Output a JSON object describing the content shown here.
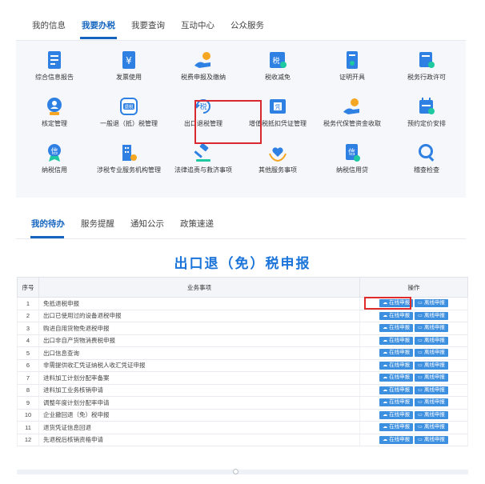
{
  "nav": {
    "tabs": [
      {
        "label": "我的信息"
      },
      {
        "label": "我要办税"
      },
      {
        "label": "我要查询"
      },
      {
        "label": "互动中心"
      },
      {
        "label": "公众服务"
      }
    ]
  },
  "tiles": [
    {
      "label": "综合信息报告",
      "icon": "report-doc-icon"
    },
    {
      "label": "发票使用",
      "icon": "invoice-yen-icon"
    },
    {
      "label": "税费申报及缴纳",
      "icon": "hand-coin-icon"
    },
    {
      "label": "税收减免",
      "icon": "tax-reduce-icon"
    },
    {
      "label": "证明开具",
      "icon": "certificate-icon"
    },
    {
      "label": "税务行政许可",
      "icon": "license-doc-icon"
    },
    {
      "label": "核定管理",
      "icon": "person-badge-icon"
    },
    {
      "label": "一般退（抵）税管理",
      "icon": "refund-tag-icon"
    },
    {
      "label": "出口退税管理",
      "icon": "export-refund-icon"
    },
    {
      "label": "增值税抵扣凭证管理",
      "icon": "voucher-icon"
    },
    {
      "label": "税务代保管资金收取",
      "icon": "hand-money-icon"
    },
    {
      "label": "预约定价安排",
      "icon": "calendar-icon"
    },
    {
      "label": "纳税信用",
      "icon": "credit-medal-icon"
    },
    {
      "label": "涉税专业服务机构管理",
      "icon": "building-gear-icon"
    },
    {
      "label": "法律追责与救济事项",
      "icon": "gavel-icon"
    },
    {
      "label": "其他服务事项",
      "icon": "heart-hands-icon"
    },
    {
      "label": "纳税信用贷",
      "icon": "credit-loan-icon"
    },
    {
      "label": "稽查检查",
      "icon": "magnifier-icon"
    }
  ],
  "second_tabs": [
    {
      "label": "我的待办"
    },
    {
      "label": "服务提醒"
    },
    {
      "label": "通知公示"
    },
    {
      "label": "政策速递"
    }
  ],
  "page_title": "出口退（免）税申报",
  "table": {
    "headers": {
      "no": "序号",
      "item": "业务事项",
      "op": "操作"
    },
    "online_label": "在线申报",
    "offline_label": "离线申报",
    "rows": [
      {
        "no": "1",
        "name": "免抵退税申报"
      },
      {
        "no": "2",
        "name": "出口已使用过的设备退税申报"
      },
      {
        "no": "3",
        "name": "购进自用货物免退税申报"
      },
      {
        "no": "4",
        "name": "出口非自产货物消费税申报"
      },
      {
        "no": "5",
        "name": "出口信息查询"
      },
      {
        "no": "6",
        "name": "非需提供收汇凭证纳税人收汇凭证申报"
      },
      {
        "no": "7",
        "name": "进料加工计划分配率备案"
      },
      {
        "no": "8",
        "name": "进料加工业务核销申请"
      },
      {
        "no": "9",
        "name": "调整年度计划分配率申请"
      },
      {
        "no": "10",
        "name": "企业撤回退（免）税申报"
      },
      {
        "no": "11",
        "name": "退货凭证信息回退"
      },
      {
        "no": "12",
        "name": "先退税后核销资格申请"
      }
    ]
  },
  "colors": {
    "accent": "#1565c0",
    "title": "#1b74d9",
    "button": "#3d8fe0",
    "highlight": "#d9282f"
  }
}
